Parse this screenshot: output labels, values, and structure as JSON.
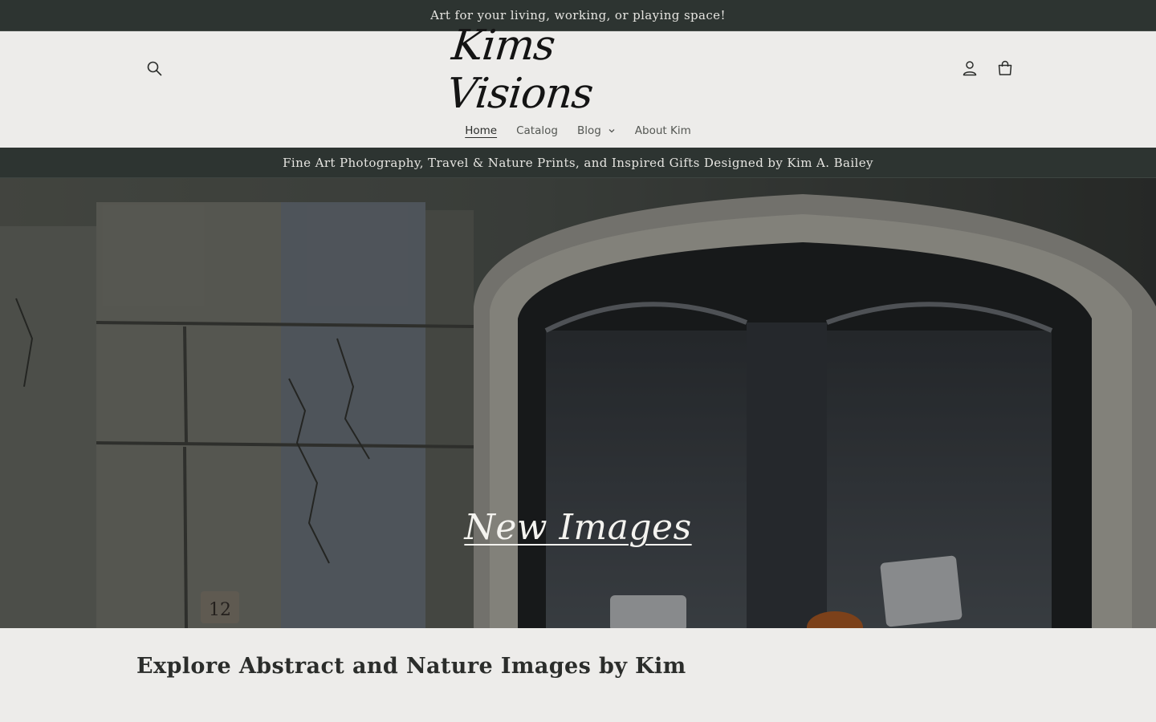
{
  "announcement": {
    "text": "Art for your living, working, or playing space!"
  },
  "header": {
    "logo_text": "Kims Visions",
    "icons": {
      "search": "search-icon",
      "account": "account-icon",
      "cart": "cart-icon"
    }
  },
  "nav": {
    "items": [
      {
        "label": "Home",
        "active": true
      },
      {
        "label": "Catalog",
        "active": false
      },
      {
        "label": "Blog",
        "active": false,
        "has_dropdown": true
      },
      {
        "label": "About Kim",
        "active": false
      }
    ]
  },
  "tagline": {
    "text": "Fine Art Photography, Travel & Nature Prints, and Inspired Gifts Designed by Kim A. Bailey"
  },
  "hero": {
    "title": "New Images",
    "image_address_number": "12"
  },
  "section": {
    "title": "Explore Abstract and Nature Images by Kim"
  },
  "colors": {
    "dark_bar": "#2d3431",
    "page_bg": "#edecea",
    "text": "#2b2d2b"
  }
}
